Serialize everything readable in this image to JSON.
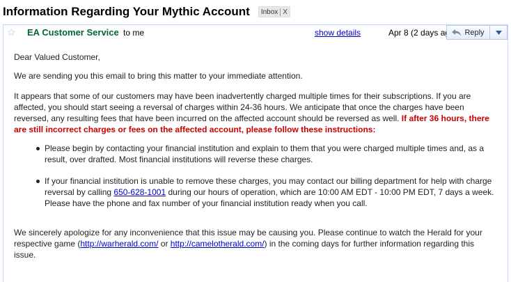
{
  "subject": "Information Regarding Your Mythic Account",
  "label": {
    "name": "Inbox",
    "remove": "X"
  },
  "header": {
    "sender": "EA Customer Service",
    "recipient": "to me",
    "show_details": "show details",
    "date": "Apr 8 (2 days ago)",
    "reply_label": "Reply"
  },
  "body": {
    "greeting": "Dear Valued Customer,",
    "intro": "We are sending you this email to bring this matter to your immediate attention.",
    "main": "It appears that some of our customers may have been inadvertently charged multiple times for their subscriptions. If you are affected, you should start seeing a reversal of charges within 24-36 hours. We anticipate that once the charges have been reversed, any resulting fees that have been incurred on the affected account should be reversed as well.",
    "warning": "If after 36 hours, there are still incorrect charges or fees on the affected account, please follow these instructions:",
    "bullet1": "Please begin by contacting your financial institution and explain to them that you were charged multiple times and, as a result, over drafted. Most financial institutions will reverse these charges.",
    "bullet2_pre": "If your financial institution is unable to remove these charges, you may contact our billing department for help with charge reversal by calling",
    "phone": "650-628-1001",
    "bullet2_post": "during our hours of operation, which are 10:00 AM EDT - 10:00 PM EDT, 7 days a week. Please have the phone and fax number of your financial institution ready when you call.",
    "closing_pre": "We sincerely apologize for any inconvenience that this issue may be causing you. Please continue to watch the Herald for your respective game (",
    "link1": "http://warherald.com/",
    "closing_or": "or",
    "link2": "http://camelotherald.com/",
    "closing_post": ") in the coming days for further information regarding this issue."
  },
  "icons": [
    "star-icon",
    "reply-arrow-icon",
    "dropdown-arrow-icon"
  ],
  "colors": {
    "sender": "#006633",
    "warning": "#cc0000",
    "link": "#0000cc",
    "border": "#c3d9ff"
  }
}
